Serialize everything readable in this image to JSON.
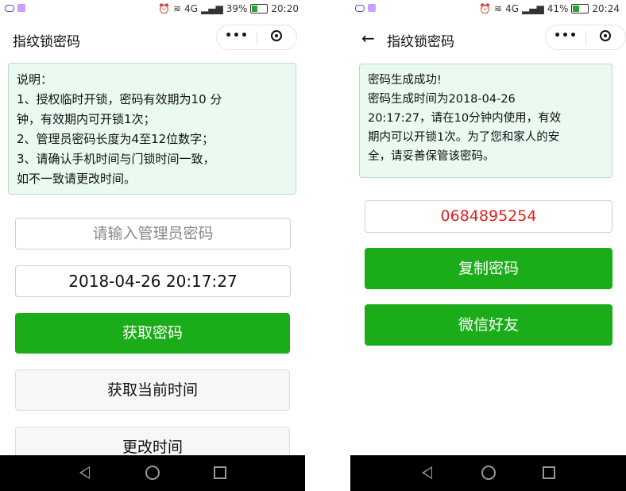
{
  "left_screen": {
    "status_bar": {
      "signal": "4G",
      "battery": "39%",
      "battery_level": 0.39,
      "time": "20:20"
    },
    "title": "指纹锁密码",
    "menu_dots": "•••",
    "note_lines": [
      "说明：",
      "1、授权临时开锁，密码有效期为10 分",
      "钟，有效期内可开锁1次；",
      "2、管理员密码长度为4至12位数字；",
      "3、请确认手机时间与门锁时间一致，",
      "如不一致请更改时间。"
    ],
    "admin_password_placeholder": "请输入管理员密码",
    "datetime_value": "2018-04-26 20:17:27",
    "get_password_button": "获取密码",
    "get_current_time_button": "获取当前时间",
    "change_time_button": "更改时间"
  },
  "right_screen": {
    "status_bar": {
      "signal": "4G",
      "battery": "41%",
      "battery_level": 0.41,
      "time": "20:24"
    },
    "title": "指纹锁密码",
    "menu_dots": "•••",
    "note_lines": [
      "密码生成成功!",
      "密码生成时间为2018-04-26",
      "20:17:27，请在10分钟内使用，有效",
      "期内可以开锁1次。为了您和家人的安",
      "全，请妥善保管该密码。"
    ],
    "generated_password": "0684895254",
    "copy_password_button": "复制密码",
    "wechat_friend_button": "微信好友"
  },
  "colors": {
    "accent_green": "#1aad19",
    "note_background": "#eafaf1",
    "password_red": "#e02020"
  },
  "icons": {
    "status_left": [
      "cloud-icon",
      "app-icon"
    ],
    "status_right": [
      "alarm-icon",
      "wifi-icon",
      "signal-icon",
      "battery-icon"
    ],
    "title_bar": [
      "back-arrow-icon",
      "more-dots-icon",
      "target-circle-icon"
    ],
    "nav_bar": [
      "back-triangle-icon",
      "home-circle-icon",
      "recent-square-icon"
    ]
  }
}
